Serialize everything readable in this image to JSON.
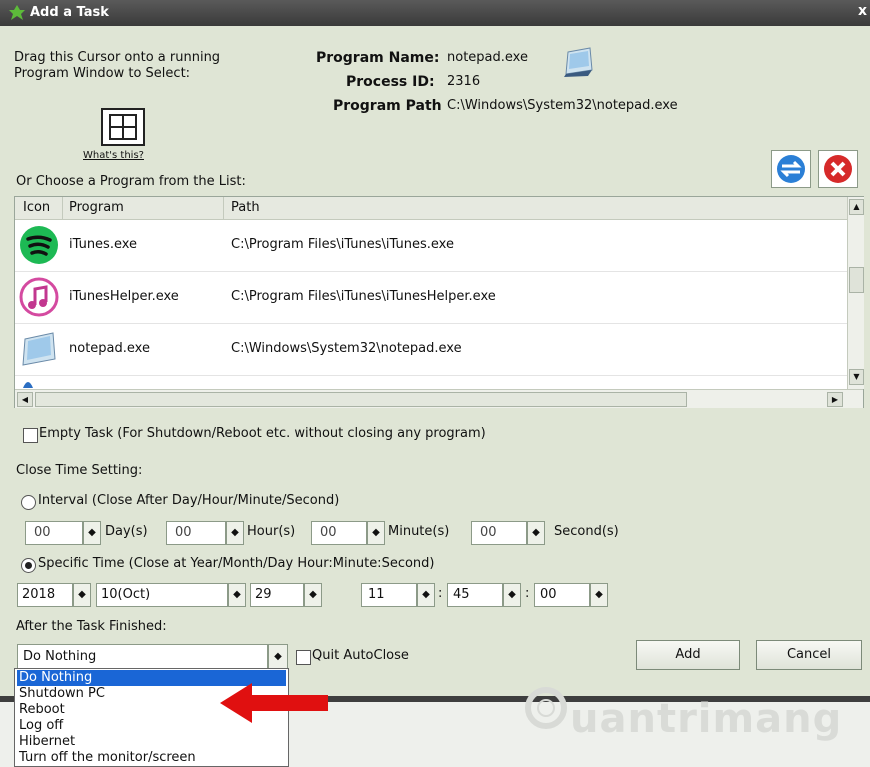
{
  "window": {
    "title": "Add a Task",
    "close_label": "x"
  },
  "drag": {
    "text": "Drag this Cursor onto a running Program Window to Select:",
    "whats_this": "What's this?"
  },
  "program_info": {
    "name_label": "Program Name:",
    "name_value": "notepad.exe",
    "pid_label": "Process ID:",
    "pid_value": "2316",
    "path_label": "Program Path",
    "path_value": "C:\\Windows\\System32\\notepad.exe"
  },
  "list": {
    "title": "Or Choose a Program from the List:",
    "columns": [
      "Icon",
      "Program",
      "Path"
    ],
    "rows": [
      {
        "program": "iTunes.exe",
        "path": "C:\\Program Files\\iTunes\\iTunes.exe",
        "icon": "spotify-icon"
      },
      {
        "program": "iTunesHelper.exe",
        "path": "C:\\Program Files\\iTunes\\iTunesHelper.exe",
        "icon": "itunes-icon"
      },
      {
        "program": "notepad.exe",
        "path": "C:\\Windows\\System32\\notepad.exe",
        "icon": "notepad-icon"
      }
    ]
  },
  "empty_task": {
    "label": "Empty Task (For Shutdown/Reboot etc. without closing any program)",
    "checked": false
  },
  "close_time": {
    "heading": "Close Time Setting:",
    "interval": {
      "label": "Interval (Close After Day/Hour/Minute/Second)",
      "selected": false,
      "day": "00",
      "day_unit": "Day(s)",
      "hour": "00",
      "hour_unit": "Hour(s)",
      "minute": "00",
      "minute_unit": "Minute(s)",
      "second": "00",
      "second_unit": "Second(s)"
    },
    "specific": {
      "label": "Specific Time (Close at Year/Month/Day Hour:Minute:Second)",
      "selected": true,
      "year": "2018",
      "month": "10(Oct)",
      "day": "29",
      "hour": "11",
      "minute": "45",
      "second": "00",
      "sep": ":"
    }
  },
  "after": {
    "heading": "After the Task Finished:",
    "selected": "Do Nothing",
    "options": [
      "Do Nothing",
      "Shutdown PC",
      "Reboot",
      "Log off",
      "Hibernet",
      "Turn off the monitor/screen"
    ],
    "quit_label": "Quit AutoClose"
  },
  "buttons": {
    "add": "Add",
    "cancel": "Cancel"
  },
  "watermark": "uantrimang",
  "colors": {
    "accent": "#1a66d6",
    "arrow": "#e01010",
    "window_bg": "#dfe5d5"
  }
}
